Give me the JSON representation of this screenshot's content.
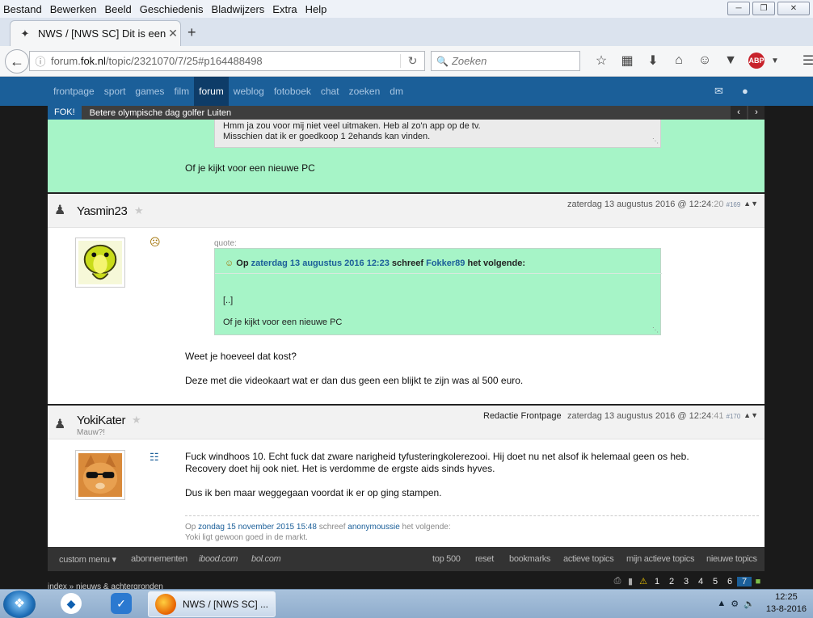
{
  "menubar": {
    "items": [
      "Bestand",
      "Bewerken",
      "Beeld",
      "Geschiedenis",
      "Bladwijzers",
      "Extra",
      "Help"
    ]
  },
  "tab": {
    "title": "NWS / [NWS SC] Dit is een ...",
    "close_icon": "close-icon"
  },
  "address": {
    "url_prefix": "forum.",
    "url_domain": "fok.nl",
    "url_path": "/topic/2321070/7/25#p164488498",
    "search_placeholder": "Zoeken"
  },
  "fok": {
    "nav": [
      "frontpage",
      "sport",
      "games",
      "film",
      "forum",
      "weblog",
      "fotoboek",
      "chat",
      "zoeken",
      "dm"
    ],
    "active": "forum",
    "ticker_label": "FOK!",
    "ticker_text": "Betere olympische dag golfer Luiten"
  },
  "post_prev": {
    "quote_lines": [
      "Hmm ja zou voor mij niet veel uitmaken. Heb al zo'n app op de tv.",
      "Misschien dat ik er goedkoop 1 2ehands kan vinden."
    ],
    "text": "Of je kijkt voor een nieuwe PC"
  },
  "post_yasmin": {
    "username": "Yasmin23",
    "date": "zaterdag 13 augustus 2016 @ 12:24",
    "seconds": ":20",
    "number": "#169",
    "quote_label": "quote:",
    "quote_prefix": "Op",
    "quote_date": "zaterdag 13 augustus 2016 12:23",
    "quote_mid": "schreef",
    "quote_user": "Fokker89",
    "quote_suffix": "het volgende:",
    "quote_body": [
      "[..]",
      "Of je kijkt voor een nieuwe PC"
    ],
    "lines": [
      "Weet je hoeveel dat kost?",
      "Deze met die videokaart wat er dan dus geen een blijkt te zijn was al 500 euro."
    ]
  },
  "post_yoki": {
    "username": "YokiKater",
    "subtitle": "Mauw?!",
    "badge": "Redactie Frontpage",
    "date": "zaterdag 13 augustus 2016 @ 12:24",
    "seconds": ":41",
    "number": "#170",
    "lines": [
      "Fuck windhoos 10. Echt fuck dat zware narigheid tyfusteringkolerezooi. Hij doet nu net alsof ik helemaal geen os heb.",
      "Recovery doet hij ook niet. Het is verdomme de ergste aids sinds hyves.",
      "Dus ik ben maar weggegaan voordat ik er op ging stampen."
    ],
    "sig_prefix": "Op",
    "sig_date": "zondag 15 november 2015 15:48",
    "sig_mid": "schreef",
    "sig_user": "anonymoussie",
    "sig_suffix": "het volgende:",
    "sig_text": "Yoki ligt gewoon goed in de markt."
  },
  "footer": {
    "left": [
      "custom menu ▾",
      "abonnementen",
      "ibood.com",
      "bol.com"
    ],
    "right": [
      "top 500",
      "reset",
      "bookmarks",
      "actieve topics",
      "mijn actieve topics",
      "nieuwe topics"
    ]
  },
  "pager": {
    "crumb": "index  »  nieuws & achtergronden",
    "pages": [
      "1",
      "2",
      "3",
      "4",
      "5",
      "6",
      "7"
    ],
    "current": "7"
  },
  "taskbar": {
    "firefox_label": "NWS / [NWS SC] ...",
    "time": "12:25",
    "date": "13-8-2016"
  }
}
